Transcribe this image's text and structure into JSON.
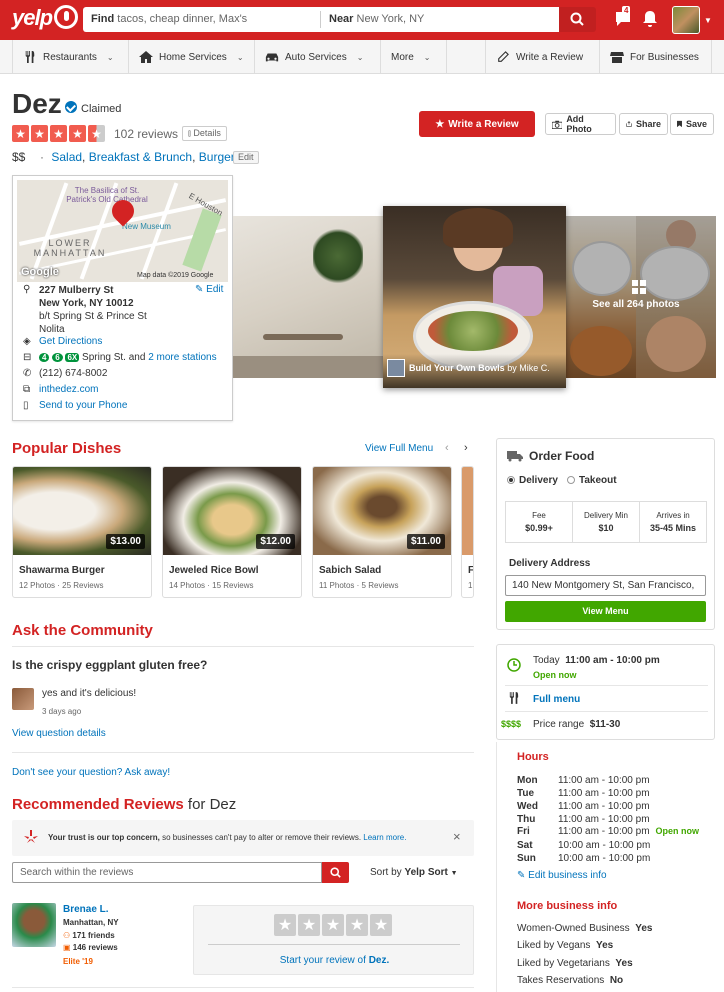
{
  "header": {
    "logo": "yelp",
    "find_label": "Find",
    "find_placeholder": "tacos, cheap dinner, Max's",
    "near_label": "Near",
    "near_value": "New York, NY",
    "notification_count": "4"
  },
  "nav": {
    "items": [
      {
        "label": "Restaurants",
        "icon": "fork-knife-icon"
      },
      {
        "label": "Home Services",
        "icon": "home-icon"
      },
      {
        "label": "Auto Services",
        "icon": "car-icon"
      },
      {
        "label": "More",
        "icon": ""
      }
    ],
    "write_review": "Write a Review",
    "for_businesses": "For Businesses"
  },
  "business": {
    "name": "Dez",
    "claimed": "Claimed",
    "rating": 4.5,
    "reviews": "102 reviews",
    "details": "Details",
    "price": "$$",
    "dot": "·",
    "categories": [
      "Salad",
      "Breakfast & Brunch",
      "Burgers"
    ],
    "edit": "Edit"
  },
  "actions": {
    "write_review": "Write a Review",
    "add_photo": "Add Photo",
    "share": "Share",
    "save": "Save"
  },
  "map": {
    "labels": [
      "The Basilica of St. Patrick's Old Cathedral",
      "E Houston",
      "New Museum",
      "LOWER MANHATTAN"
    ],
    "google": "Google",
    "map_data": "Map data ©2019 Google",
    "address1": "227 Mulberry St",
    "address2": "New York, NY 10012",
    "cross": "b/t Spring St & Prince St",
    "neighborhood": "Nolita",
    "edit": "Edit",
    "directions": "Get Directions",
    "subway_lines": [
      "4",
      "6",
      "6X"
    ],
    "subway_text": "Spring St. and",
    "more_stations": "2 more stations",
    "phone": "(212) 674-8002",
    "website": "inthedez.com",
    "send_phone": "Send to your Phone"
  },
  "photos": {
    "caption_title": "Build Your Own Bowls",
    "caption_by": "by Mike C.",
    "see_all": "See all 264 photos"
  },
  "popular_dishes": {
    "title": "Popular Dishes",
    "view_full_menu": "View Full Menu",
    "items": [
      {
        "name": "Shawarma Burger",
        "price": "$13.00",
        "photos": "12 Photos",
        "reviews": "25 Reviews"
      },
      {
        "name": "Jeweled Rice Bowl",
        "price": "$12.00",
        "photos": "14 Photos",
        "reviews": "15 Reviews"
      },
      {
        "name": "Sabich Salad",
        "price": "$11.00",
        "photos": "11 Photos",
        "reviews": "5 Reviews"
      },
      {
        "name": "F",
        "price": "",
        "photos": "1",
        "reviews": ""
      }
    ]
  },
  "order_food": {
    "title": "Order Food",
    "delivery": "Delivery",
    "takeout": "Takeout",
    "fee_label": "Fee",
    "fee_value": "$0.99+",
    "min_label": "Delivery Min",
    "min_value": "$10",
    "arrives_label": "Arrives in",
    "arrives_value": "35-45 Mins",
    "address_label": "Delivery Address",
    "address_value": "140 New Montgomery St, San Francisco,",
    "view_menu": "View Menu"
  },
  "today": {
    "label": "Today",
    "hours": "11:00 am - 10:00 pm",
    "status": "Open now",
    "full_menu": "Full menu",
    "price_symbol": "$$$$",
    "price_range_label": "Price range",
    "price_range": "$11-30"
  },
  "community": {
    "title": "Ask the Community",
    "question": "Is the crispy eggplant gluten free?",
    "answer": "yes and it's delicious!",
    "answer_time": "3 days ago",
    "view_details": "View question details",
    "ask": "Don't see your question? Ask away!"
  },
  "hours": {
    "title": "Hours",
    "rows": [
      {
        "day": "Mon",
        "time": "11:00 am - 10:00 pm",
        "note": ""
      },
      {
        "day": "Tue",
        "time": "11:00 am - 10:00 pm",
        "note": ""
      },
      {
        "day": "Wed",
        "time": "11:00 am - 10:00 pm",
        "note": ""
      },
      {
        "day": "Thu",
        "time": "11:00 am - 10:00 pm",
        "note": ""
      },
      {
        "day": "Fri",
        "time": "11:00 am - 10:00 pm",
        "note": "Open now"
      },
      {
        "day": "Sat",
        "time": "10:00 am - 10:00 pm",
        "note": ""
      },
      {
        "day": "Sun",
        "time": "10:00 am - 10:00 pm",
        "note": ""
      }
    ],
    "edit": "Edit business info"
  },
  "reviews_section": {
    "title": "Recommended Reviews",
    "for": "for Dez",
    "trust_bold": "Your trust is our top concern,",
    "trust_text": "so businesses can't pay to alter or remove their reviews.",
    "learn_more": "Learn more.",
    "search_placeholder": "Search within the reviews",
    "sort_label": "Sort by",
    "sort_value": "Yelp Sort",
    "reviewer_name": "Brenae L.",
    "reviewer_location": "Manhattan, NY",
    "friends": "171 friends",
    "reviews": "146 reviews",
    "elite": "Elite '19",
    "start_review": "Start your review of",
    "start_review_biz": "Dez."
  },
  "more_info": {
    "title": "More business info",
    "rows": [
      {
        "label": "Women-Owned Business",
        "value": "Yes"
      },
      {
        "label": "Liked by Vegans",
        "value": "Yes"
      },
      {
        "label": "Liked by Vegetarians",
        "value": "Yes"
      },
      {
        "label": "Takes Reservations",
        "value": "No"
      }
    ]
  },
  "colors": {
    "brand": "#d32323",
    "link": "#0073bb",
    "green": "#41a700",
    "star": "#f15c4f"
  }
}
